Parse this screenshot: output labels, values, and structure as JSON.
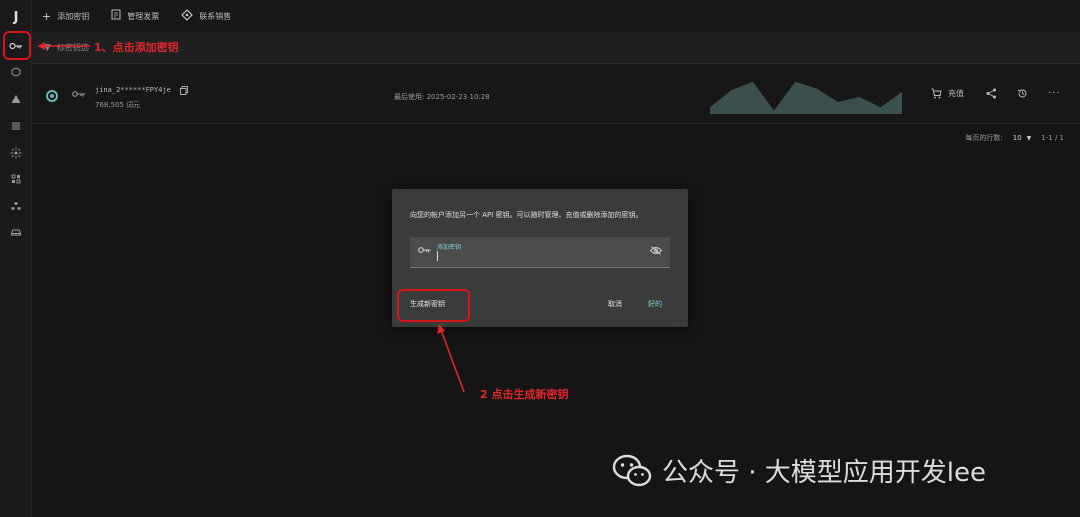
{
  "rail": {
    "logo": "J",
    "items": [
      {
        "name": "key-icon"
      },
      {
        "name": "cube-icon"
      },
      {
        "name": "triangle-icon"
      },
      {
        "name": "list-icon"
      },
      {
        "name": "atom-icon"
      },
      {
        "name": "grid-icon"
      },
      {
        "name": "nodes-icon"
      },
      {
        "name": "car-icon"
      }
    ]
  },
  "topbar": {
    "add_key": "添加密钥",
    "manage_invoice": "管理发票",
    "contact_sales": "联系销售"
  },
  "subbar": {
    "label": "标密钥选"
  },
  "key": {
    "name": "jina_2******FPY4je",
    "balance": "768,505 词元",
    "last_used": "最后使用: 2025-02-23 10:28",
    "recharge": "充值",
    "sparkline": [
      0.2,
      0.7,
      0.95,
      0.1,
      0.95,
      0.75,
      0.35,
      0.5,
      0.2,
      0.65
    ]
  },
  "pagination": {
    "rows_label": "每页的行数:",
    "rows_value": "10",
    "range": "1-1 / 1"
  },
  "dialog": {
    "text": "向您的帐户添加另一个 API 密钥。可以随时管理、充值或删除添加的密钥。",
    "field_label": "添加密钥",
    "field_value": "",
    "generate": "生成新密钥",
    "cancel": "取消",
    "ok": "好的"
  },
  "annotations": {
    "step1": "1、点击添加密钥",
    "step2": "2 点击生成新密钥",
    "color": "#e0252b"
  },
  "watermark": {
    "text": "公众号 · 大模型应用开发lee"
  },
  "colors": {
    "accent": "#69b7b2",
    "link": "#7fd3d6",
    "highlight": "#d7141a"
  }
}
